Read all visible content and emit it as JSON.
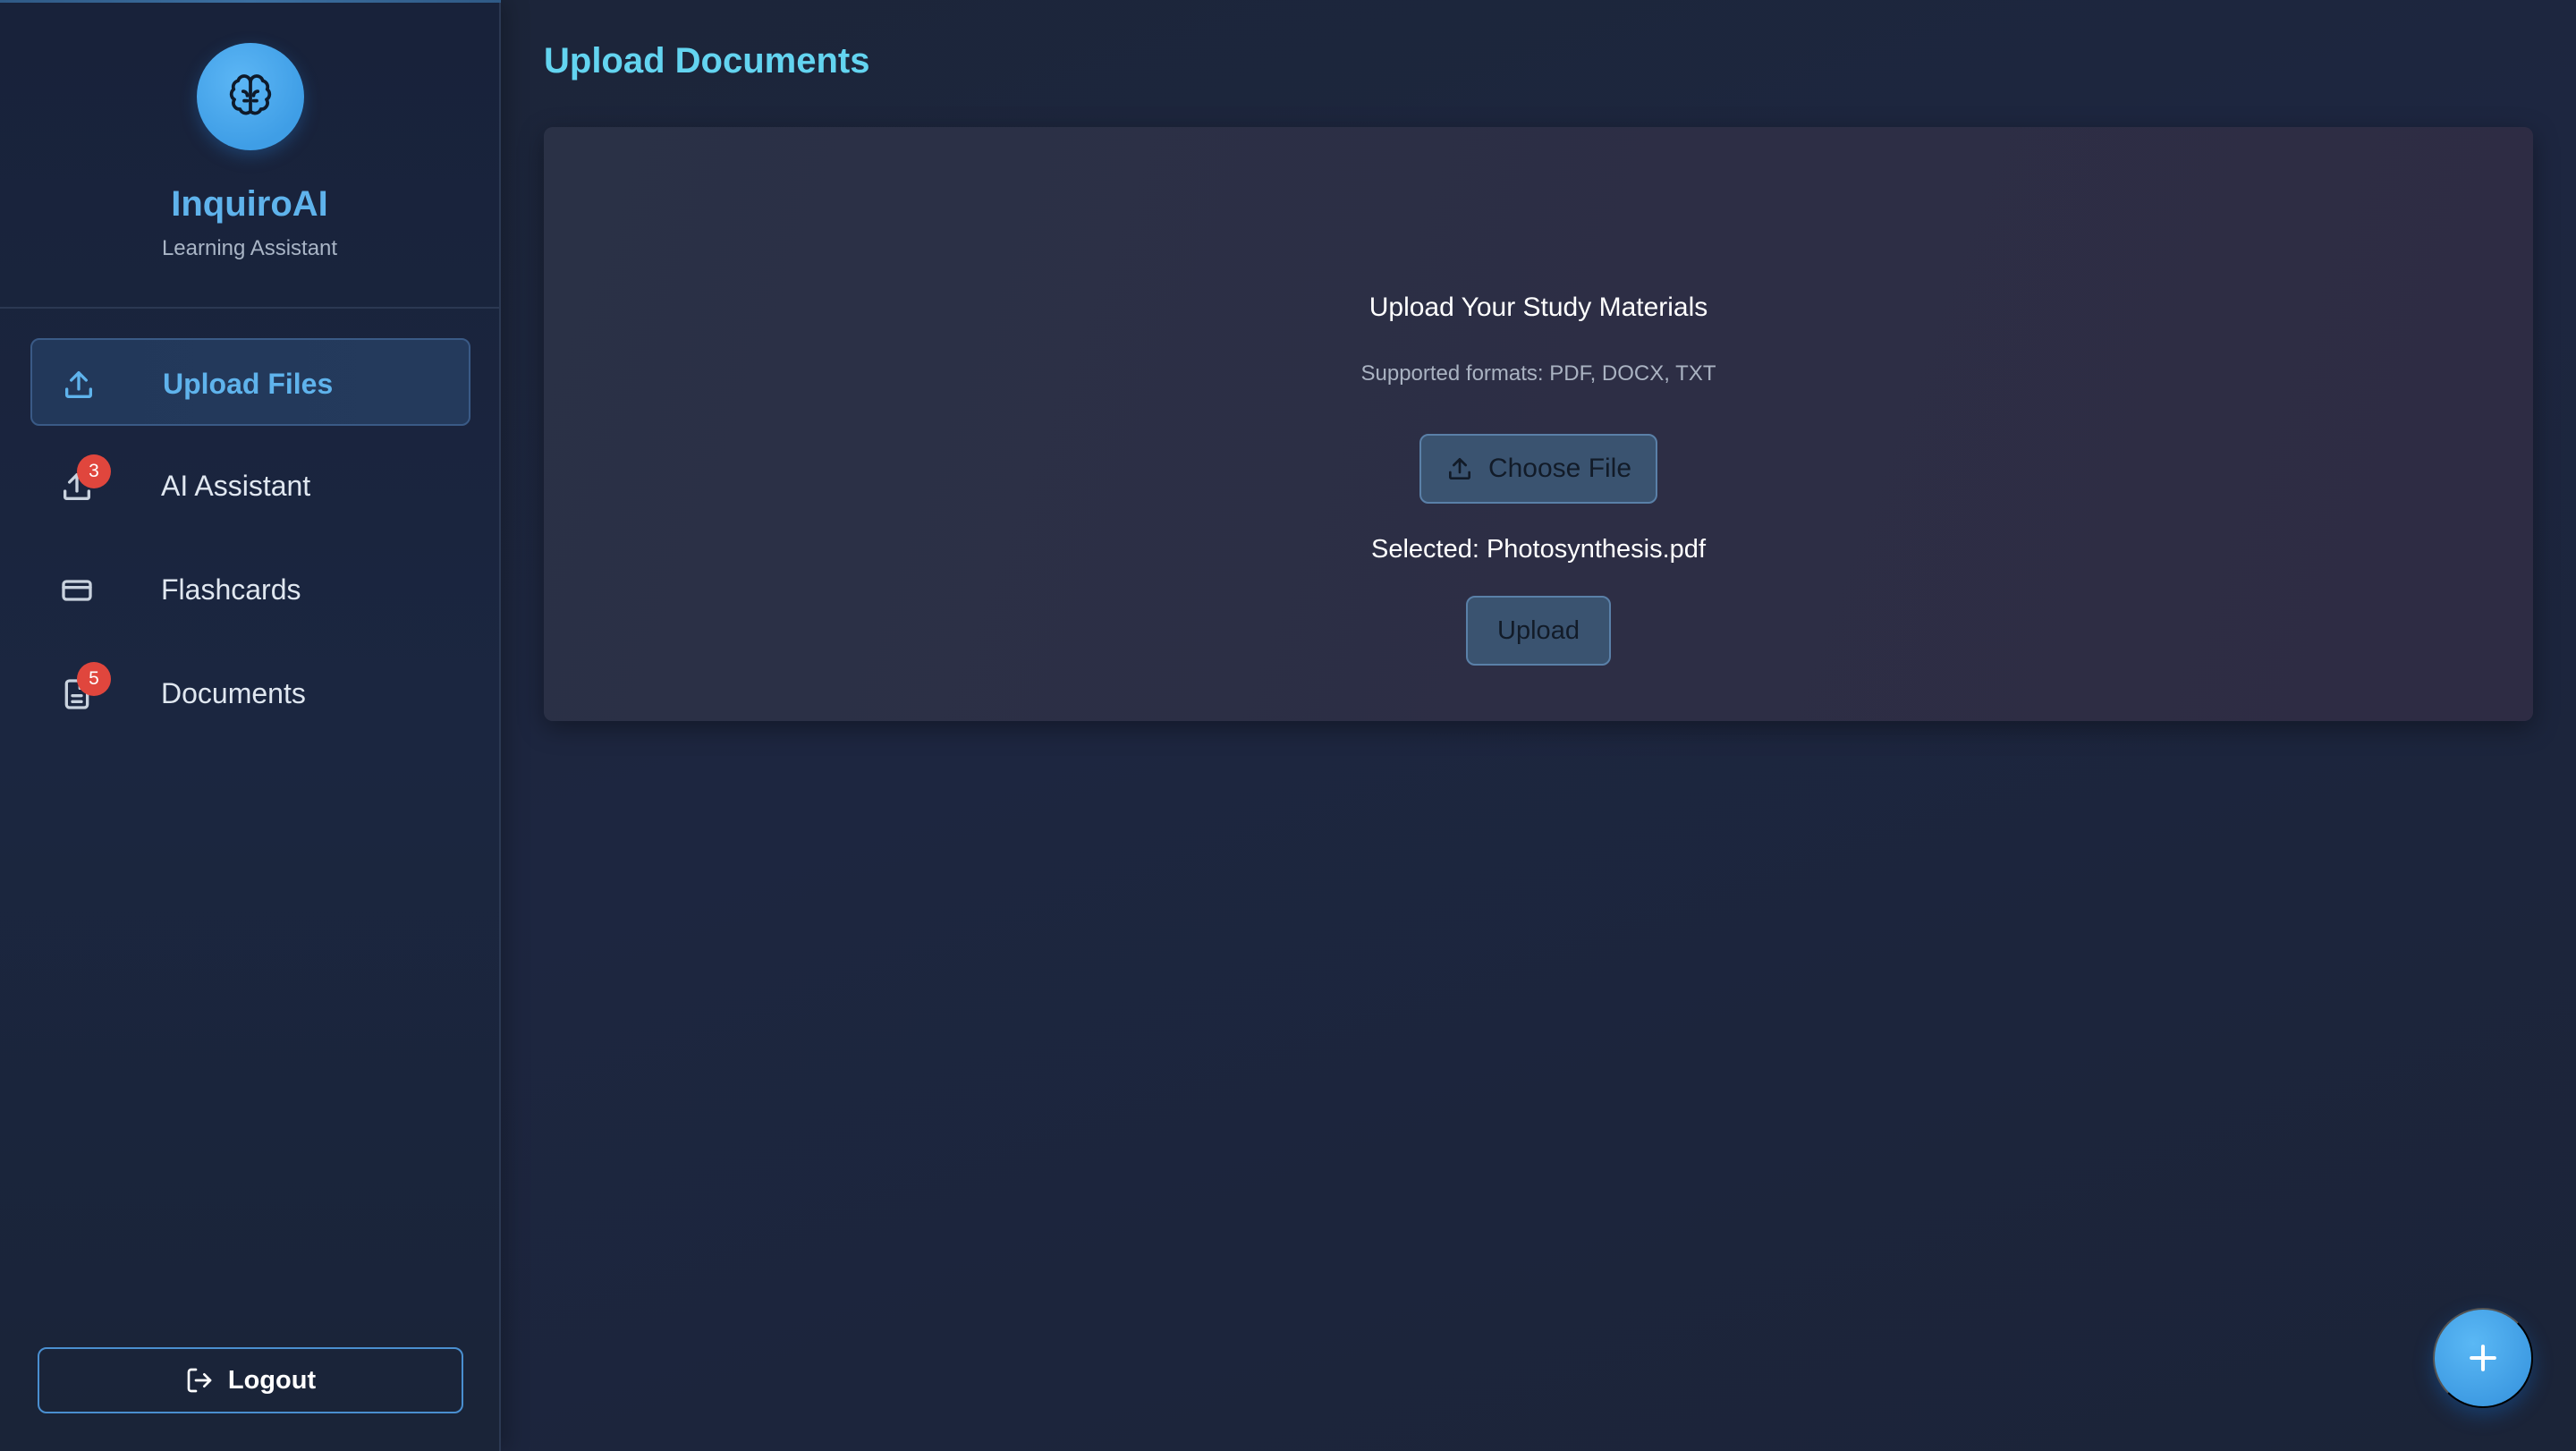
{
  "brand": {
    "name": "InquiroAI",
    "subtitle": "Learning Assistant",
    "logo_icon": "brain-icon"
  },
  "sidebar": {
    "items": [
      {
        "label": "Upload Files",
        "icon": "upload-icon",
        "active": true,
        "badge": ""
      },
      {
        "label": "AI Assistant",
        "icon": "upload-icon",
        "active": false,
        "badge": "3"
      },
      {
        "label": "Flashcards",
        "icon": "card-icon",
        "active": false,
        "badge": ""
      },
      {
        "label": "Documents",
        "icon": "document-icon",
        "active": false,
        "badge": "5"
      }
    ],
    "logout_label": "Logout"
  },
  "main": {
    "title": "Upload Documents",
    "card": {
      "title": "Upload Your Study Materials",
      "subtitle": "Supported formats: PDF, DOCX, TXT",
      "choose_label": "Choose File",
      "selected_text": "Selected: Photosynthesis.pdf",
      "upload_label": "Upload"
    }
  },
  "fab": {
    "icon": "plus-icon"
  },
  "colors": {
    "accent": "#5fb3ec",
    "title": "#63d4f0",
    "badge": "#e0463d",
    "background": "#1c2538"
  }
}
